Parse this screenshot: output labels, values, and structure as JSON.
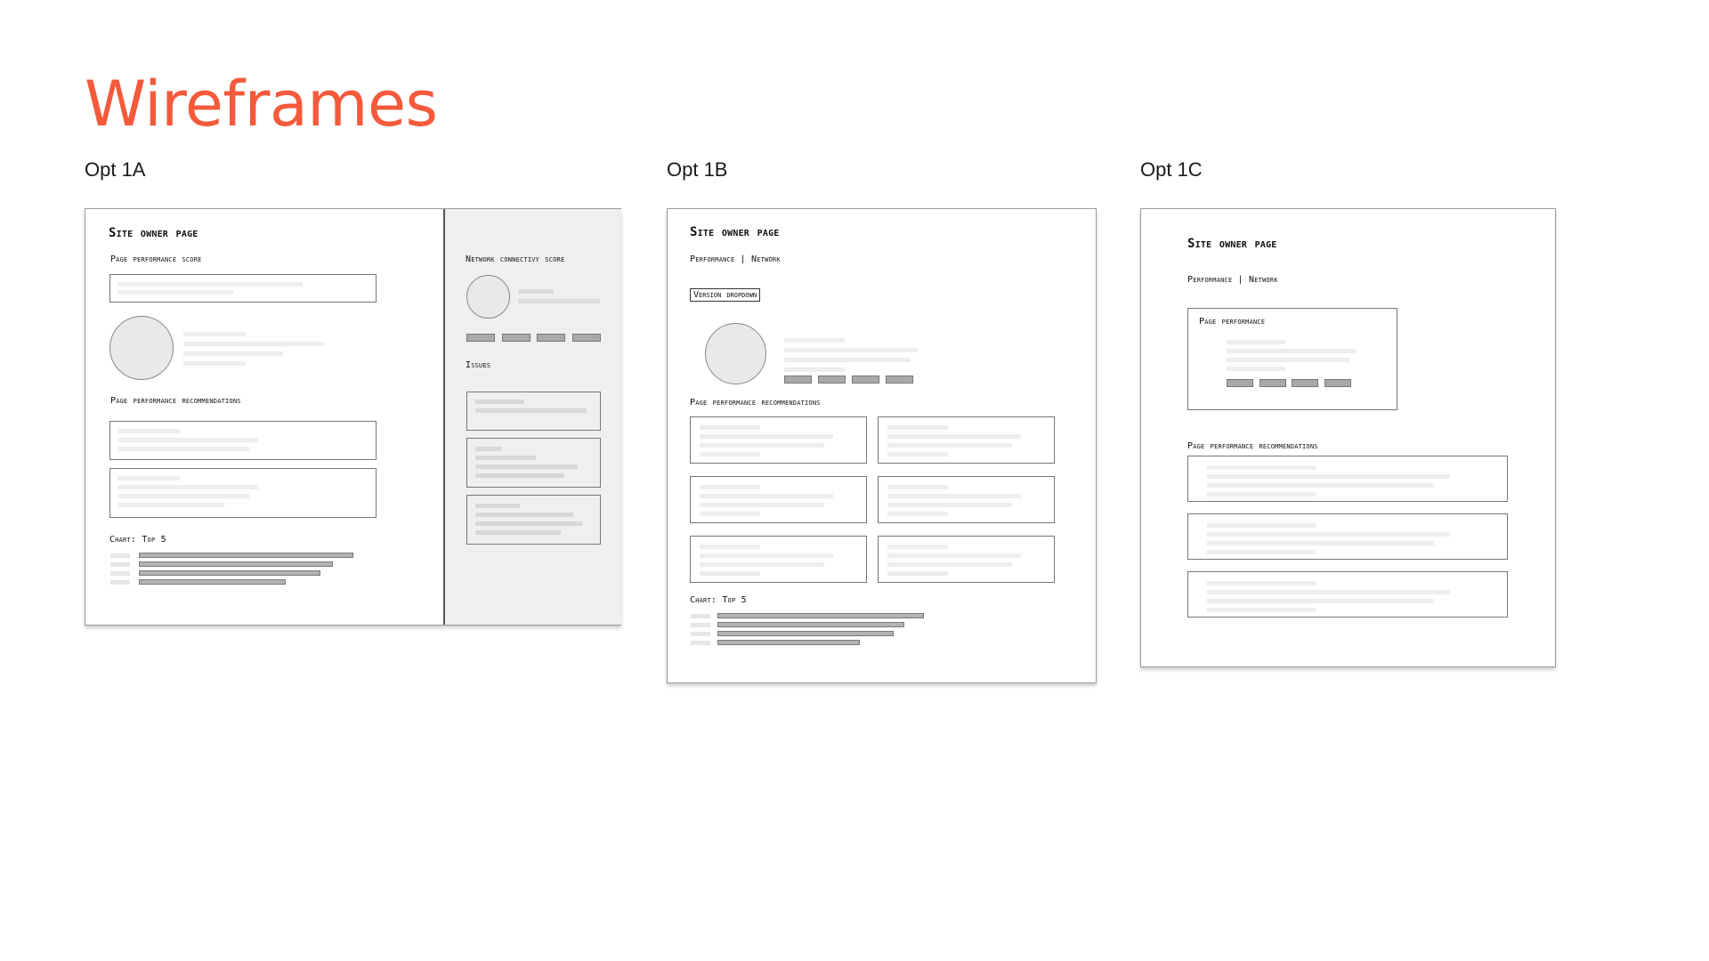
{
  "title": "Wireframes",
  "options": [
    {
      "label": "Opt 1A",
      "page_title": "Site owner page",
      "score_label": "Page performance score",
      "recommendations_label": "Page performance recommendations",
      "chart_label": "Chart: Top 5",
      "side_panel": {
        "network_label": "Network connectivy score",
        "issues_label": "Issues"
      }
    },
    {
      "label": "Opt 1B",
      "page_title": "Site owner page",
      "tabs": "Performance | Network",
      "version_dropdown": "Version dropdown",
      "recommendations_label": "Page performance recommendations",
      "chart_label": "Chart: Top 5"
    },
    {
      "label": "Opt 1C",
      "page_title": "Site owner page",
      "tabs": "Performance | Network",
      "performance_card_label": "Page performance",
      "recommendations_label": "Page performance recommendations"
    }
  ],
  "colors": {
    "title": "#f45a3b",
    "frame_border": "#9a9a9a",
    "side_panel_bg": "#efefef"
  }
}
